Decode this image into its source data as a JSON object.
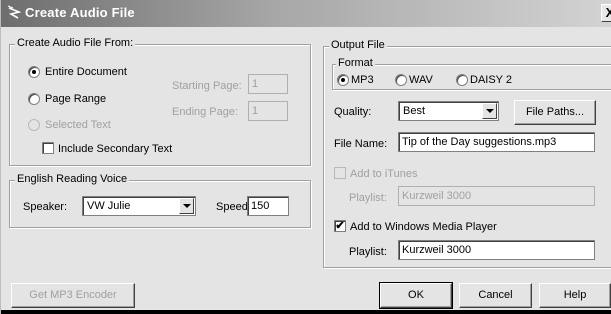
{
  "window": {
    "title": "Create Audio File",
    "close_glyph": "X"
  },
  "source_group": {
    "legend": "Create Audio File From:",
    "entire_document": "Entire Document",
    "page_range": "Page Range",
    "selected_text": "Selected Text",
    "starting_page_label": "Starting Page:",
    "starting_page_value": "1",
    "ending_page_label": "Ending Page:",
    "ending_page_value": "1",
    "include_secondary": "Include Secondary Text",
    "selected_option": "entire_document"
  },
  "voice_group": {
    "legend": "English Reading Voice",
    "speaker_label": "Speaker:",
    "speaker_value": "VW Julie",
    "speed_label": "Speed:",
    "speed_value": "150"
  },
  "output_group": {
    "legend": "Output File",
    "format_legend": "Format",
    "formats": [
      "MP3",
      "WAV",
      "DAISY 2"
    ],
    "selected_format": "MP3",
    "quality_label": "Quality:",
    "quality_value": "Best",
    "file_paths_button": "File Paths...",
    "file_name_label": "File Name:",
    "file_name_value": "Tip of the Day suggestions.mp3",
    "itunes_label": "Add to iTunes",
    "itunes_playlist_label": "Playlist:",
    "itunes_playlist_value": "Kurzweil 3000",
    "wmp_label": "Add to Windows Media Player",
    "wmp_checked": true,
    "wmp_playlist_label": "Playlist:",
    "wmp_playlist_value": "Kurzweil 3000"
  },
  "buttons": {
    "mp3_encoder": "Get MP3 Encoder",
    "ok": "OK",
    "cancel": "Cancel",
    "help": "Help"
  },
  "glyphs": {
    "check": "✔"
  }
}
